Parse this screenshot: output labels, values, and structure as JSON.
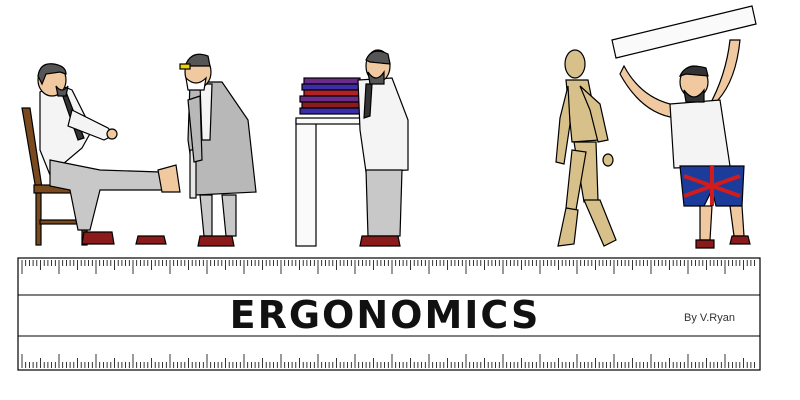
{
  "banner": {
    "title": "ERGONOMICS",
    "credit": "By V.Ryan"
  },
  "illustration": {
    "figures": [
      "seated-man-icon",
      "doctor-with-ruler-icon",
      "man-with-books-icon",
      "wooden-mannequin-icon",
      "strongman-with-ruler-icon"
    ]
  },
  "colors": {
    "outline": "#000000",
    "shirt": "#f4f4f4",
    "trousers": "#c8c8c8",
    "coat": "#b8b8b8",
    "wood": "#d8c08a",
    "chair": "#7a4a1e",
    "shoes": "#8b1a1a",
    "books": [
      "#3c2ea8",
      "#b22222",
      "#6a2b8a",
      "#8a1c1c"
    ],
    "flag_blue": "#1c3c9c",
    "flag_red": "#d01c1c"
  }
}
